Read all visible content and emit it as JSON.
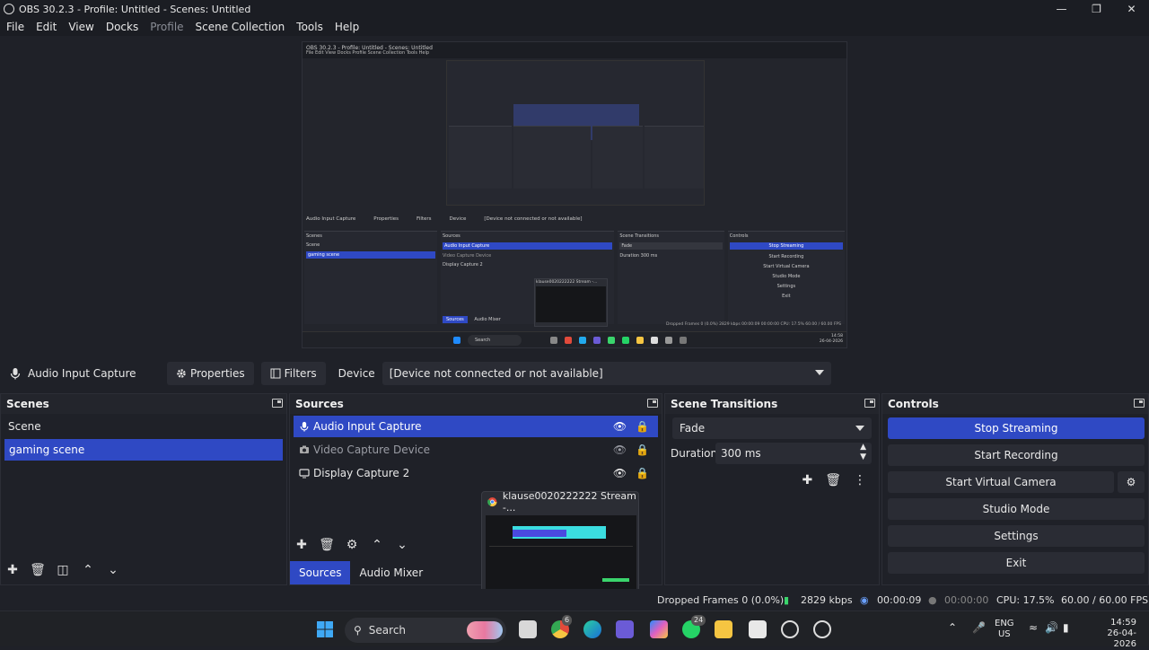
{
  "window": {
    "title": "OBS 30.2.3 - Profile: Untitled - Scenes: Untitled"
  },
  "menu": {
    "file": "File",
    "edit": "Edit",
    "view": "View",
    "docks": "Docks",
    "profile": "Profile",
    "scene_collection": "Scene Collection",
    "tools": "Tools",
    "help": "Help"
  },
  "source_toolbar": {
    "source_name": "Audio Input Capture",
    "properties_label": "Properties",
    "filters_label": "Filters",
    "device_label": "Device",
    "device_value": "[Device not connected or not available]"
  },
  "scenes": {
    "title": "Scenes",
    "items": [
      {
        "label": "Scene"
      },
      {
        "label": "gaming scene",
        "selected": true
      }
    ]
  },
  "sources": {
    "title": "Sources",
    "items": [
      {
        "label": "Audio Input Capture",
        "selected": true
      },
      {
        "label": "Video Capture Device",
        "hidden": true
      },
      {
        "label": "Display Capture 2"
      }
    ],
    "tabs": {
      "sources": "Sources",
      "audio_mixer": "Audio Mixer"
    }
  },
  "transitions": {
    "title": "Scene Transitions",
    "selected": "Fade",
    "duration_label": "Duration",
    "duration_value": "300 ms"
  },
  "controls": {
    "title": "Controls",
    "stop_streaming": "Stop Streaming",
    "start_recording": "Start Recording",
    "start_virtual_camera": "Start Virtual Camera",
    "studio_mode": "Studio Mode",
    "settings": "Settings",
    "exit": "Exit"
  },
  "popup": {
    "title": "klause0020222222 Stream -..."
  },
  "status": {
    "dropped_frames": "Dropped Frames 0 (0.0%)",
    "bitrate": "2829 kbps",
    "stream_time": "00:00:09",
    "record_time": "00:00:00",
    "cpu": "CPU: 17.5%",
    "fps": "60.00 / 60.00 FPS"
  },
  "taskbar": {
    "search_label": "Search",
    "lang_line1": "ENG",
    "lang_line2": "US",
    "time": "14:59",
    "date": "26-04-2026",
    "chrome_badge": "6",
    "whatsapp_badge": "24"
  },
  "preview_mini": {
    "title": "OBS 30.2.3 - Profile: Untitled - Scenes: Untitled",
    "menu": "File   Edit   View   Docks   Profile   Scene Collection   Tools   Help",
    "source_name": "Audio Input Capture",
    "properties": "Properties",
    "filters": "Filters",
    "device": "Device",
    "device_value": "[Device not connected or not available]",
    "scenes": "Scenes",
    "scene1": "Scene",
    "scene2": "gaming scene",
    "sources": "Sources",
    "src1": "Audio Input Capture",
    "src2": "Video Capture Device",
    "src3": "Display Capture 2",
    "popup": "klause0020222222 Stream -...",
    "tab_sources": "Sources",
    "tab_mixer": "Audio Mixer",
    "transitions": "Scene Transitions",
    "fade": "Fade",
    "duration": "Duration",
    "duration_value": "300 ms",
    "controls": "Controls",
    "stop_streaming": "Stop Streaming",
    "start_recording": "Start Recording",
    "virtual_camera": "Start Virtual Camera",
    "studio_mode": "Studio Mode",
    "settings": "Settings",
    "exit": "Exit",
    "status": "Dropped Frames 0 (0.0%)   2829 kbps   00:00:09   00:00:00   CPU: 17.5%   60.00 / 60.00 FPS",
    "search": "Search",
    "time": "14:58",
    "date": "26-04-2026"
  }
}
